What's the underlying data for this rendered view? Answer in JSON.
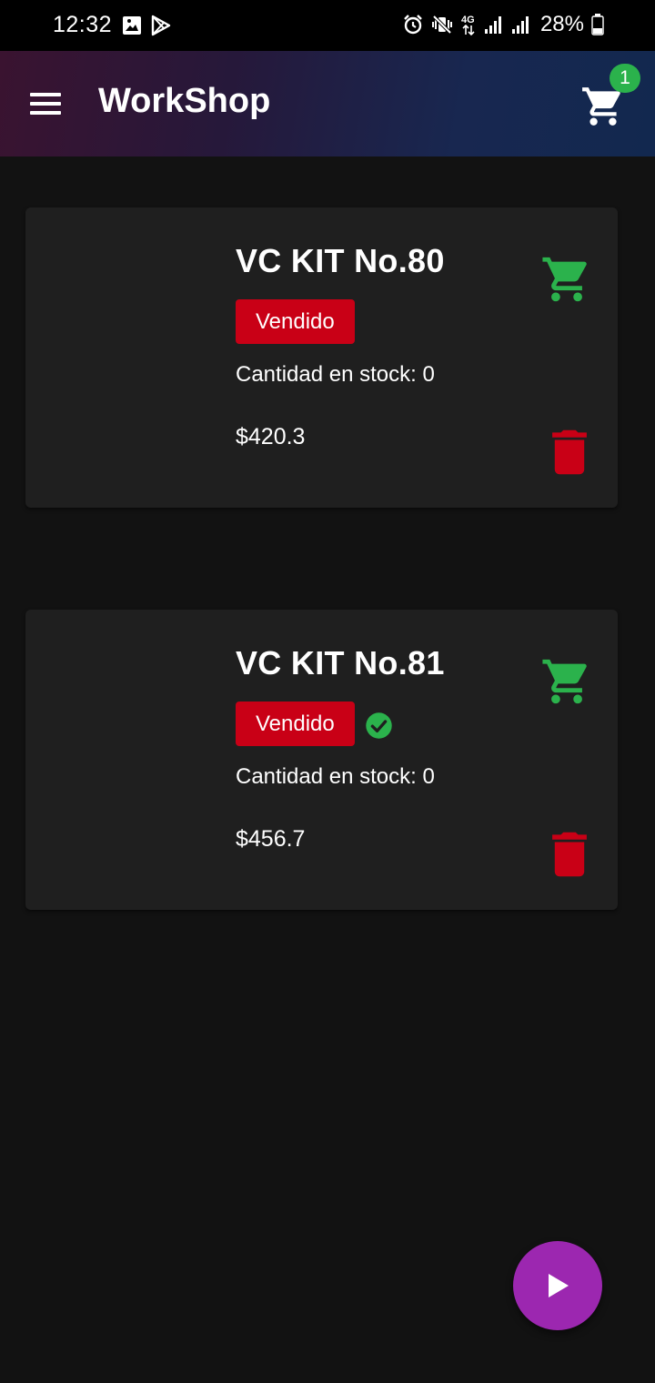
{
  "status_bar": {
    "time": "12:32",
    "battery_percent": "28%",
    "icons": [
      "gallery-icon",
      "play-store-icon",
      "alarm-icon",
      "vibrate-mute-icon",
      "4g-icon",
      "signal-icon",
      "signal-icon",
      "battery-icon"
    ]
  },
  "app_bar": {
    "title": "WorkShop",
    "cart_count": "1",
    "menu_icon": "menu-icon",
    "cart_icon": "shopping-cart-icon"
  },
  "products": [
    {
      "name": "VC KIT No.80",
      "badge": "Vendido",
      "stock": "Cantidad en stock: 0",
      "price": "$420.3",
      "checked": false
    },
    {
      "name": "VC KIT No.81",
      "badge": "Vendido",
      "stock": "Cantidad en stock: 0",
      "price": "$456.7",
      "checked": true
    }
  ],
  "fab": {
    "icon": "play-icon"
  },
  "colors": {
    "background": "#121212",
    "card": "#1f1f1f",
    "sold_badge": "#c90016",
    "cart_green": "#2bb24c",
    "delete_red": "#c90016",
    "fab": "#9c27b0"
  }
}
